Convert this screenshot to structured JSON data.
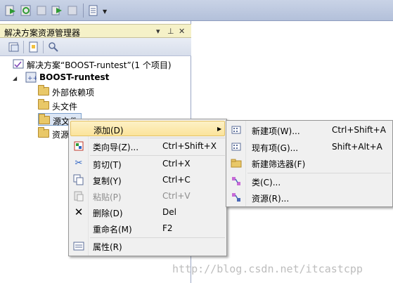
{
  "panel": {
    "title": "解决方案资源管理器",
    "pin_glyph": "▾",
    "dock_glyph": "⊿",
    "close_glyph": "✕"
  },
  "tree": {
    "solution": "解决方案“BOOST-runtest”(1 个项目)",
    "project": "BOOST-runtest",
    "items": [
      "外部依赖项",
      "头文件",
      "源文件",
      "资源"
    ]
  },
  "context_menu": {
    "items": [
      {
        "label": "添加(D)",
        "key": ""
      },
      {
        "label": "类向导(Z)...",
        "key": "Ctrl+Shift+X"
      },
      {
        "label": "剪切(T)",
        "key": "Ctrl+X"
      },
      {
        "label": "复制(Y)",
        "key": "Ctrl+C"
      },
      {
        "label": "粘贴(P)",
        "key": "Ctrl+V"
      },
      {
        "label": "删除(D)",
        "key": "Del"
      },
      {
        "label": "重命名(M)",
        "key": "F2"
      },
      {
        "label": "属性(R)",
        "key": ""
      }
    ]
  },
  "submenu": {
    "items": [
      {
        "label": "新建项(W)...",
        "key": "Ctrl+Shift+A"
      },
      {
        "label": "现有项(G)...",
        "key": "Shift+Alt+A"
      },
      {
        "label": "新建筛选器(F)",
        "key": ""
      },
      {
        "label": "类(C)...",
        "key": ""
      },
      {
        "label": "资源(R)...",
        "key": ""
      }
    ]
  },
  "watermark": "http://blog.csdn.net/itcastcpp",
  "colors": {
    "toolbar_bg": "#b3c0da",
    "title_bg": "#f5f1c8",
    "menu_bg": "#f0f0f0",
    "highlight": "#fbe39a"
  }
}
